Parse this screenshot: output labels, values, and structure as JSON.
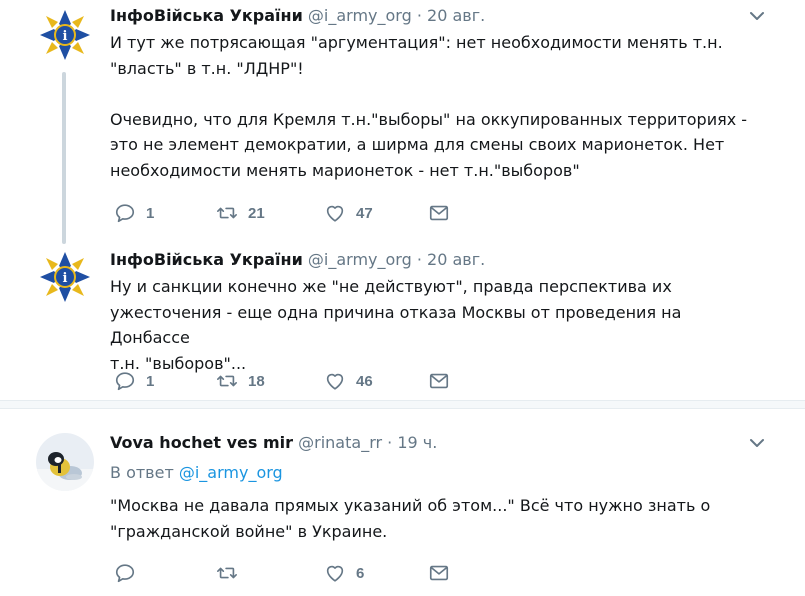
{
  "tweets": [
    {
      "author_name": "ІнфоВійська України",
      "handle": "@i_army_org",
      "separator": "·",
      "time": "20 авг.",
      "lines": [
        "И тут же потрясающая \"аргументация\": нет необходимости менять т.н.",
        "\"власть\" в т.н. \"ЛДНР\"!",
        "Очевидно, что для Кремля т.н.\"выборы\" на оккупированных территориях -",
        "это не элемент демократии, а ширма для смены своих марионеток. Нет",
        "необходимости менять марионеток - нет т.н.\"выборов\""
      ],
      "replies": "1",
      "retweets": "21",
      "likes": "47"
    },
    {
      "author_name": "ІнфоВійська України",
      "handle": "@i_army_org",
      "separator": "·",
      "time": "20 авг.",
      "lines": [
        "Ну и санкции конечно же \"не действуют\", правда перспектива их",
        "ужесточения - еще одна причина отказа Москвы от проведения на Донбассе",
        "т.н. \"выборов\"..."
      ],
      "replies": "1",
      "retweets": "18",
      "likes": "46"
    },
    {
      "author_name": "Vova hochet ves mir",
      "handle": "@rinata_rr",
      "separator": "·",
      "time": "19 ч.",
      "reply_prefix": "В ответ",
      "reply_handle": "@i_army_org",
      "lines": [
        "\"Москва не давала прямых указаний об этом...\" Всё что нужно знать о",
        "\"гражданской войне\" в Украине."
      ],
      "likes": "6"
    }
  ],
  "colors": {
    "text": "#14171a",
    "secondary": "#657786",
    "link": "#1b95e0",
    "divider": "#e6ecf0"
  }
}
